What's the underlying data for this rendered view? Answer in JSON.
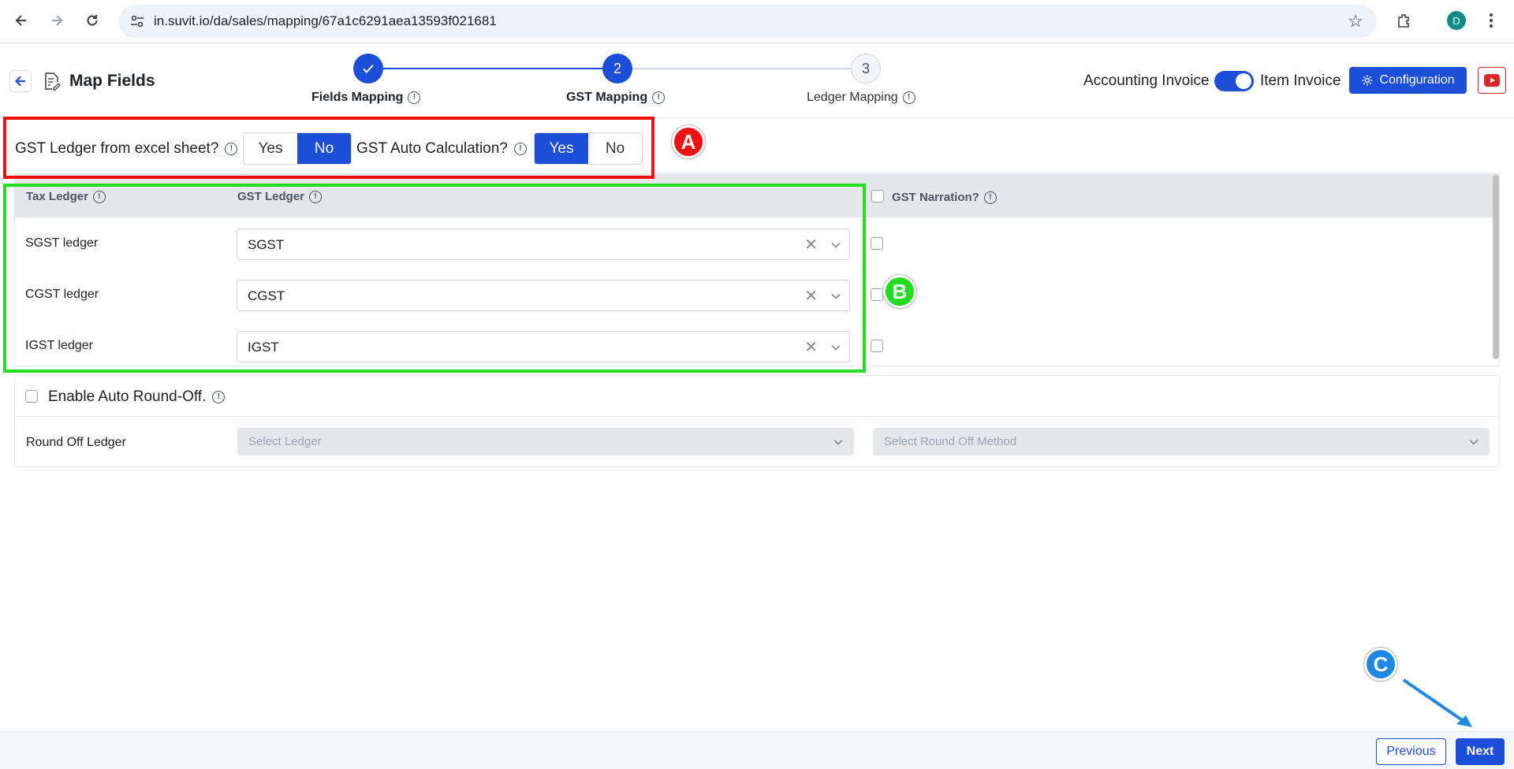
{
  "browser": {
    "url": "in.suvit.io/da/sales/mapping/67a1c6291aea13593f021681",
    "profile_initial": "D"
  },
  "header": {
    "title": "Map Fields",
    "steps": [
      {
        "number": "1",
        "label": "Fields Mapping",
        "state": "done"
      },
      {
        "number": "2",
        "label": "GST Mapping",
        "state": "active"
      },
      {
        "number": "3",
        "label": "Ledger Mapping",
        "state": "pending"
      }
    ],
    "toggle_left_label": "Accounting Invoice",
    "toggle_right_label": "Item Invoice",
    "configuration_label": "Configuration"
  },
  "options": {
    "gst_ledger_label": "GST Ledger from excel sheet?",
    "gst_ledger_yes": "Yes",
    "gst_ledger_no": "No",
    "gst_ledger_selected": "No",
    "auto_calc_label": "GST Auto Calculation?",
    "auto_calc_yes": "Yes",
    "auto_calc_no": "No",
    "auto_calc_selected": "Yes"
  },
  "annotations": {
    "a": "A",
    "b": "B",
    "c": "C"
  },
  "table": {
    "headers": {
      "tax_ledger": "Tax Ledger",
      "gst_ledger": "GST Ledger",
      "gst_narration": "GST Narration?"
    },
    "rows": [
      {
        "label": "SGST ledger",
        "value": "SGST"
      },
      {
        "label": "CGST ledger",
        "value": "CGST"
      },
      {
        "label": "IGST ledger",
        "value": "IGST"
      }
    ]
  },
  "round_off": {
    "title": "Enable Auto Round-Off.",
    "ledger_label": "Round Off Ledger",
    "ledger_placeholder": "Select Ledger",
    "method_placeholder": "Select Round Off Method"
  },
  "footer": {
    "previous_label": "Previous",
    "next_label": "Next"
  },
  "colors": {
    "primary": "#1d4ed8",
    "annotation_a": "#ee1111",
    "annotation_b": "#22dd22",
    "annotation_c": "#1e88e5"
  }
}
